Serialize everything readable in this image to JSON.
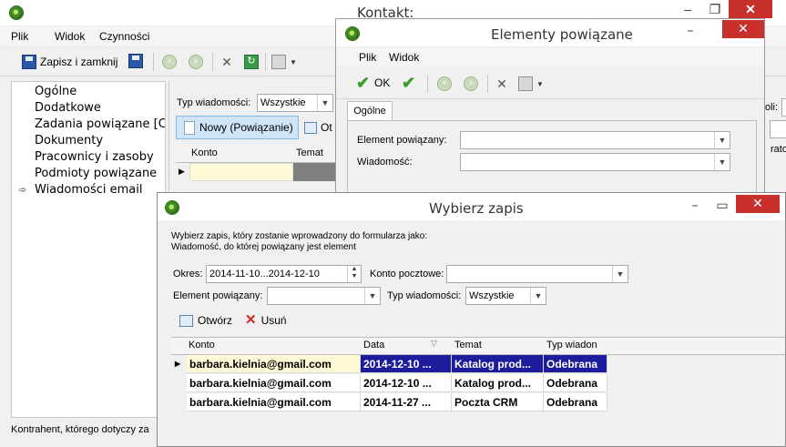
{
  "main_window": {
    "title": "Kontakt:",
    "menu": [
      "Plik",
      "Widok",
      "Czynności"
    ],
    "toolbar": {
      "save_close": "Zapisz i zamknij"
    },
    "nav_items": [
      "Ogólne",
      "Dodatkowe",
      "Zadania powiązane [Ctr",
      "Dokumenty",
      "Pracownicy i zasoby",
      "Podmioty powiązane",
      "Wiadomości email"
    ],
    "active_nav_index": 6,
    "type_label": "Typ wiadomości:",
    "type_value": "Wszystkie",
    "new_button": "Nowy (Powiązanie)",
    "open_button_partial": "Ot",
    "grid_columns": [
      "Konto",
      "Temat"
    ],
    "status_text": "Kontrahent, którego dotyczy za",
    "right_partial_label": "oli:",
    "right_partial_text": "rato"
  },
  "elements_window": {
    "title": "Elementy powiązane",
    "menu": [
      "Plik",
      "Widok"
    ],
    "ok_label": "OK",
    "tab_label": "Ogólne",
    "element_label": "Element powiązany:",
    "message_label": "Wiadomość:"
  },
  "select_window": {
    "title": "Wybierz zapis",
    "description_line1": "Wybierz zapis, który zostanie wprowadzony do formularza jako:",
    "description_line2": "Wiadomość, do której powiązany jest element",
    "period_label": "Okres:",
    "period_value": "2014-11-10...2014-12-10",
    "account_label": "Konto pocztowe:",
    "element_label": "Element powiązany:",
    "type_label": "Typ wiadomości:",
    "type_value": "Wszystkie",
    "open_button": "Otwórz",
    "delete_button": "Usuń",
    "columns": [
      "Konto",
      "Data",
      "Temat",
      "Typ wiadon"
    ],
    "rows": [
      {
        "konto": "barbara.kielnia@gmail.com",
        "data": "2014-12-10 ...",
        "temat": "Katalog prod...",
        "typ": "Odebrana"
      },
      {
        "konto": "barbara.kielnia@gmail.com",
        "data": "2014-12-10 ...",
        "temat": "Katalog prod...",
        "typ": "Odebrana"
      },
      {
        "konto": "barbara.kielnia@gmail.com",
        "data": "2014-11-27 ...",
        "temat": "Poczta  CRM",
        "typ": "Odebrana"
      }
    ]
  },
  "colors": {
    "selected_row": "#1c1c9c",
    "selected_row_text": "#ffffff",
    "accent_button": "#cfe5f7",
    "close_button": "#c7302b"
  }
}
